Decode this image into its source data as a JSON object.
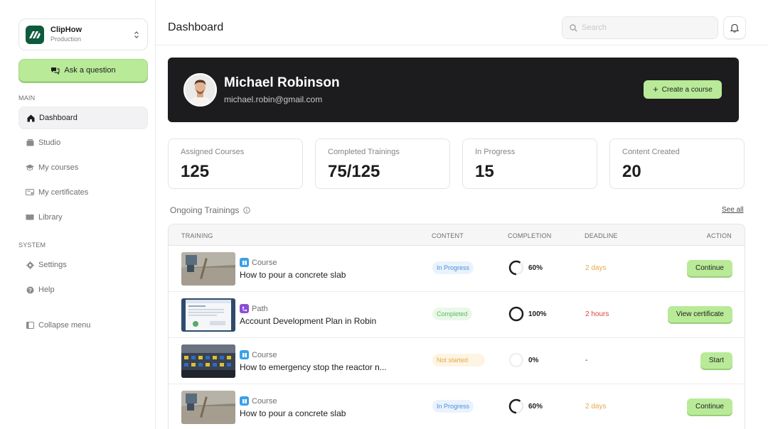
{
  "org": {
    "name": "ClipHow",
    "environment": "Production",
    "logo_color": "#0f5a3c"
  },
  "sidebar": {
    "ask_label": "Ask a question",
    "main_label": "MAIN",
    "main_items": [
      {
        "label": "Dashboard",
        "icon": "home-icon",
        "active": true
      },
      {
        "label": "Studio",
        "icon": "studio-icon"
      },
      {
        "label": "My courses",
        "icon": "graduation-cap-icon"
      },
      {
        "label": "My certificates",
        "icon": "certificate-icon"
      },
      {
        "label": "Library",
        "icon": "book-icon"
      }
    ],
    "system_label": "SYSTEM",
    "system_items": [
      {
        "label": "Settings",
        "icon": "gear-icon"
      },
      {
        "label": "Help",
        "icon": "help-icon"
      }
    ],
    "collapse_label": "Collapse menu"
  },
  "header": {
    "title": "Dashboard",
    "search_placeholder": "Search"
  },
  "hero": {
    "name": "Michael Robinson",
    "email": "michael.robin@gmail.com",
    "create_label": "Create a course"
  },
  "stats": [
    {
      "label": "Assigned Courses",
      "value": "125"
    },
    {
      "label": "Completed Trainings",
      "value": "75/125"
    },
    {
      "label": "In Progress",
      "value": "15"
    },
    {
      "label": "Content Created",
      "value": "20"
    }
  ],
  "ongoing": {
    "title": "Ongoing Trainings",
    "see_all": "See all"
  },
  "table": {
    "columns": {
      "training": "TRAINING",
      "content": "CONTENT",
      "completion": "COMPLETION",
      "deadline": "DEADLINE",
      "action": "ACTION"
    },
    "rows": [
      {
        "type": "Course",
        "title": "How to pour a concrete slab",
        "status": "In Progress",
        "completion": "60%",
        "completion_fraction": 0.6,
        "deadline": "2 days",
        "action": "Continue"
      },
      {
        "type": "Path",
        "title": "Account Development Plan in Robin",
        "status": "Completed",
        "completion": "100%",
        "completion_fraction": 1.0,
        "deadline": "2 hours",
        "action": "View certificate"
      },
      {
        "type": "Course",
        "title": "How to emergency stop the reactor n...",
        "status": "Not started",
        "completion": "0%",
        "completion_fraction": 0,
        "deadline": "-",
        "action": "Start"
      },
      {
        "type": "Course",
        "title": "How to pour a concrete slab",
        "status": "In Progress",
        "completion": "60%",
        "completion_fraction": 0.6,
        "deadline": "2 days",
        "action": "Continue"
      }
    ]
  },
  "colors": {
    "accent": "#b9ea98",
    "hero_bg": "#1c1c1e",
    "course_icon": "#3aa0e8",
    "path_icon": "#8a4fd8"
  }
}
